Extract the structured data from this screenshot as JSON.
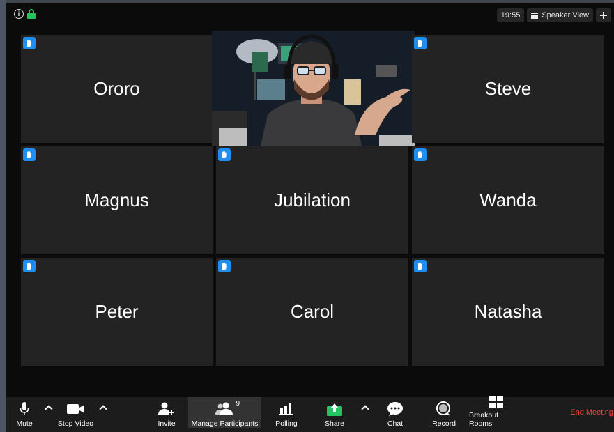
{
  "topbar": {
    "time": "19:55",
    "view_mode": "Speaker View",
    "icons": [
      "info-icon",
      "lock-icon",
      "speaker-view-icon",
      "fullscreen-icon"
    ]
  },
  "participants": [
    {
      "name": "Ororo",
      "hand_raised": true
    },
    {
      "name": "",
      "hand_raised": false,
      "video": true
    },
    {
      "name": "Steve",
      "hand_raised": true
    },
    {
      "name": "Magnus",
      "hand_raised": true
    },
    {
      "name": "Jubilation",
      "hand_raised": true
    },
    {
      "name": "Wanda",
      "hand_raised": true
    },
    {
      "name": "Peter",
      "hand_raised": true
    },
    {
      "name": "Carol",
      "hand_raised": true
    },
    {
      "name": "Natasha",
      "hand_raised": true
    }
  ],
  "toolbar": {
    "mute": "Mute",
    "stop_video": "Stop Video",
    "invite": "Invite",
    "manage_participants": "Manage Participants",
    "participant_count": "9",
    "polling": "Polling",
    "share": "Share",
    "chat": "Chat",
    "record": "Record",
    "breakout_rooms": "Breakout Rooms",
    "end_meeting": "End Meeting"
  },
  "colors": {
    "hand_badge": "#1f8ef1",
    "share_green": "#22c55e",
    "end_red": "#ef4444",
    "tile_bg": "#232323"
  }
}
